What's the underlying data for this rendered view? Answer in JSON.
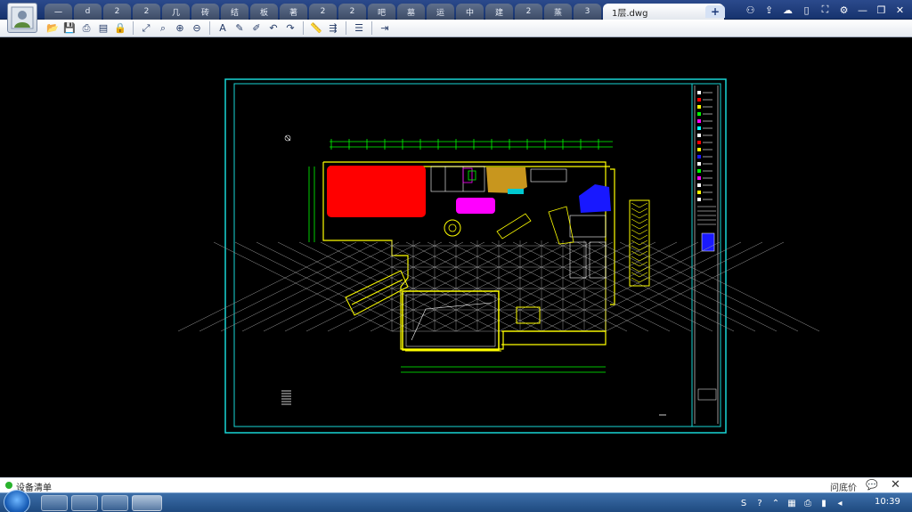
{
  "tabs": [
    "一",
    "d",
    "2",
    "2",
    "几",
    "砖",
    "结",
    "板",
    "著",
    "2",
    "2",
    "吧",
    "墓",
    "运",
    "中",
    "建",
    "2",
    "蒸",
    "3"
  ],
  "active_tab": {
    "label": "1层.dwg",
    "close": "✕"
  },
  "new_tab": "+",
  "top_icons": [
    "users-icon",
    "share-icon",
    "cloud-icon",
    "phone-icon",
    "fullscreen-icon",
    "settings-icon",
    "minimize-icon",
    "restore-icon",
    "close-icon"
  ],
  "top_glyphs": [
    "⚇",
    "⇪",
    "☁",
    "▯",
    "⛶",
    "⚙",
    "—",
    "❐",
    "✕"
  ],
  "toolbar": {
    "items": [
      {
        "name": "open-icon",
        "g": "📂"
      },
      {
        "name": "save-icon",
        "g": "💾"
      },
      {
        "name": "print-icon",
        "g": "⎙"
      },
      {
        "name": "pdf-icon",
        "g": "▤"
      },
      {
        "name": "lock-icon",
        "g": "🔒"
      },
      {
        "sep": true
      },
      {
        "name": "pan-icon",
        "g": "⤢"
      },
      {
        "name": "zoom-window-icon",
        "g": "⌕"
      },
      {
        "name": "zoom-in-icon",
        "g": "⊕"
      },
      {
        "name": "zoom-out-icon",
        "g": "⊖"
      },
      {
        "sep": true
      },
      {
        "name": "text-icon",
        "g": "A"
      },
      {
        "name": "pen-icon",
        "g": "✎"
      },
      {
        "name": "marker-icon",
        "g": "✐"
      },
      {
        "name": "undo-icon",
        "g": "↶"
      },
      {
        "name": "redo-icon",
        "g": "↷"
      },
      {
        "sep": true
      },
      {
        "name": "measure-icon",
        "g": "📏"
      },
      {
        "name": "dimension-icon",
        "g": "⇶"
      },
      {
        "sep": true
      },
      {
        "name": "layers-icon",
        "g": "☰"
      },
      {
        "sep": true
      },
      {
        "name": "export-icon",
        "g": "⇥"
      }
    ]
  },
  "status": {
    "text": "设备清单",
    "price": "问底价",
    "chat": "💬",
    "close": "✕"
  },
  "taskbar": {
    "clock": "10:39",
    "tray": [
      "S",
      "?",
      "⌃",
      "▦",
      "⎙",
      "▮",
      "◂"
    ]
  },
  "colors": {
    "frame": "#19d6d6",
    "red_block": "#ff0000",
    "magenta_block": "#ff00ff",
    "orange_block": "#c8961e",
    "blue_block": "#1818ff",
    "line_yellow": "#ffff00",
    "line_green": "#00ff00",
    "line_white": "#e8e8e8"
  }
}
